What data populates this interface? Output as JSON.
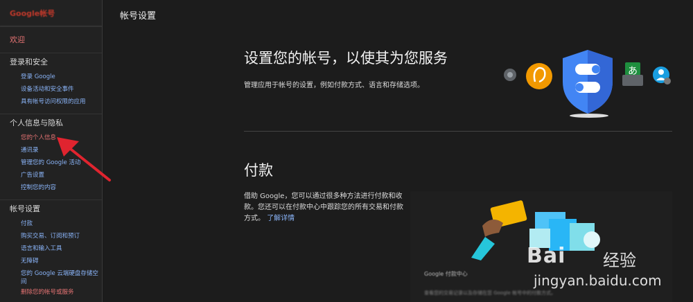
{
  "sidebar": {
    "logo": "Google帐号",
    "sections": [
      {
        "title": "欢迎",
        "items": []
      },
      {
        "title": "登录和安全",
        "items": [
          "登录 Google",
          "设备活动和安全事件",
          "具有帐号访问权限的应用"
        ]
      },
      {
        "title": "个人信息与隐私",
        "items": [
          "您的个人信息",
          "通讯录",
          "管理您的 Google 活动",
          "广告设置",
          "控制您的内容"
        ]
      },
      {
        "title": "帐号设置",
        "items": [
          "付款",
          "购买交易、订阅和预订",
          "语言和输入工具",
          "无障碍",
          "您的 Google 云端硬盘存储空间",
          "删除您的帐号或服务"
        ]
      }
    ],
    "active_item": "您的个人信息"
  },
  "header": {
    "title": "帐号设置"
  },
  "main": {
    "hero_title": "设置您的帐号，以使其为您服务",
    "hero_desc": "管理应用于帐号的设置，例如付款方式、语言和存储选项。",
    "payment_title": "付款",
    "payment_desc": "借助 Google，您可以通过很多种方法进行付款和收款。您还可以在付款中心中跟踪您的所有交易和付款方式。",
    "payment_link": "了解详情",
    "card_title": "Google 付款中心",
    "card_text": "查看您的交易记录以及存储在您 Google 帐号中的付款方式。"
  },
  "watermark": {
    "brand_a": "Bai",
    "brand_b": "经验",
    "url": "jingyan.baidu.com"
  },
  "icons": [
    "gear-icon",
    "hearing-icon",
    "shield-icon",
    "keyboard-icon",
    "user-icon",
    "payment-card-icon",
    "shopping-bag-icon",
    "arrow-annotation-icon"
  ],
  "colors": {
    "accent": "#8ab4f8",
    "active": "#e57373",
    "shield": "#4285f4",
    "orange": "#f29900"
  }
}
